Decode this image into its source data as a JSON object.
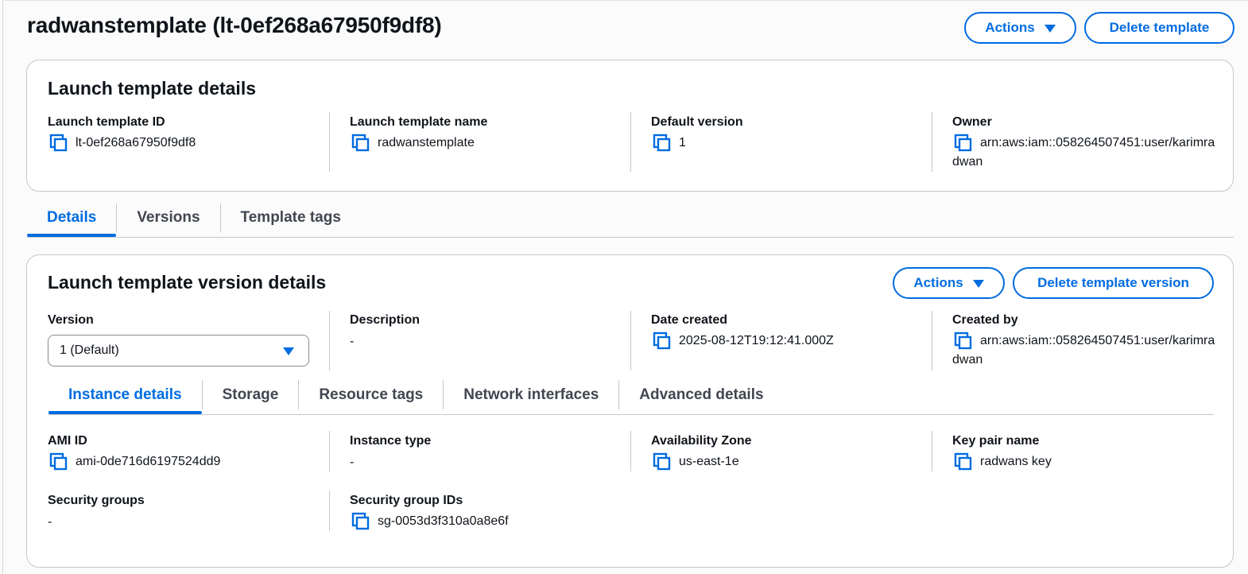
{
  "header": {
    "title": "radwanstemplate (lt-0ef268a67950f9df8)",
    "actions_label": "Actions",
    "delete_label": "Delete template"
  },
  "template_details": {
    "title": "Launch template details",
    "fields": [
      {
        "label": "Launch template ID",
        "value": "lt-0ef268a67950f9df8"
      },
      {
        "label": "Launch template name",
        "value": "radwanstemplate"
      },
      {
        "label": "Default version",
        "value": "1"
      },
      {
        "label": "Owner",
        "value": "arn:aws:iam::058264507451:user/karimradwan"
      }
    ]
  },
  "main_tabs": [
    {
      "label": "Details",
      "active": true
    },
    {
      "label": "Versions",
      "active": false
    },
    {
      "label": "Template tags",
      "active": false
    }
  ],
  "version_details": {
    "title": "Launch template version details",
    "actions_label": "Actions",
    "delete_label": "Delete template version",
    "version_label": "Version",
    "version_selected": "1 (Default)",
    "description_label": "Description",
    "description_value": "-",
    "date_created_label": "Date created",
    "date_created_value": "2025-08-12T19:12:41.000Z",
    "created_by_label": "Created by",
    "created_by_value": "arn:aws:iam::058264507451:user/karimradwan"
  },
  "sub_tabs": [
    {
      "label": "Instance details",
      "active": true
    },
    {
      "label": "Storage",
      "active": false
    },
    {
      "label": "Resource tags",
      "active": false
    },
    {
      "label": "Network interfaces",
      "active": false
    },
    {
      "label": "Advanced details",
      "active": false
    }
  ],
  "instance_details": {
    "ami_label": "AMI ID",
    "ami_value": "ami-0de716d6197524dd9",
    "instance_type_label": "Instance type",
    "instance_type_value": "-",
    "az_label": "Availability Zone",
    "az_value": "us-east-1e",
    "key_pair_label": "Key pair name",
    "key_pair_value": "radwans key",
    "sg_label": "Security groups",
    "sg_value": "-",
    "sg_ids_label": "Security group IDs",
    "sg_ids_value": "sg-0053d3f310a0a8e6f"
  },
  "icons": {
    "copy": "copy-icon",
    "dropdown": "caret-down-icon"
  },
  "colors": {
    "accent": "#006ce0",
    "text": "#0f141a",
    "border": "#c6c6cd"
  }
}
